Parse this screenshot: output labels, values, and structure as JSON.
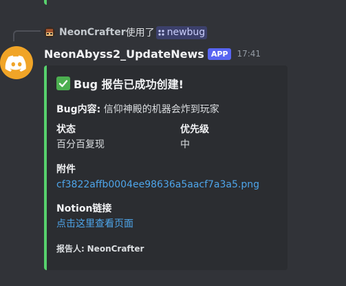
{
  "reply": {
    "user": "NeonCrafter",
    "used_text": "使用了",
    "command": "newbug"
  },
  "message": {
    "author": "NeonAbyss2_UpdateNews",
    "badge": "APP",
    "timestamp": "17:41"
  },
  "embed": {
    "accent_color": "#57d16d",
    "title_icon": "check-mark-icon",
    "title": "Bug 报告已成功创建!",
    "description_label": "Bug内容:",
    "description_value": "信仰神殿的机器会炸到玩家",
    "fields": [
      {
        "name": "状态",
        "value": "百分百复现"
      },
      {
        "name": "优先级",
        "value": "中"
      },
      {
        "name": "附件",
        "value": "cf3822affb0004ee98636a5aacf7a3a5.png"
      },
      {
        "name": "Notion链接",
        "value": "点击这里查看页面"
      }
    ],
    "footer_label": "报告人:",
    "footer_value": "NeonCrafter"
  },
  "colors": {
    "background": "#313338",
    "embed_background": "#2b2d31",
    "app_badge": "#5865f2",
    "avatar": "#f0a427",
    "link": "#4ea5ea"
  }
}
